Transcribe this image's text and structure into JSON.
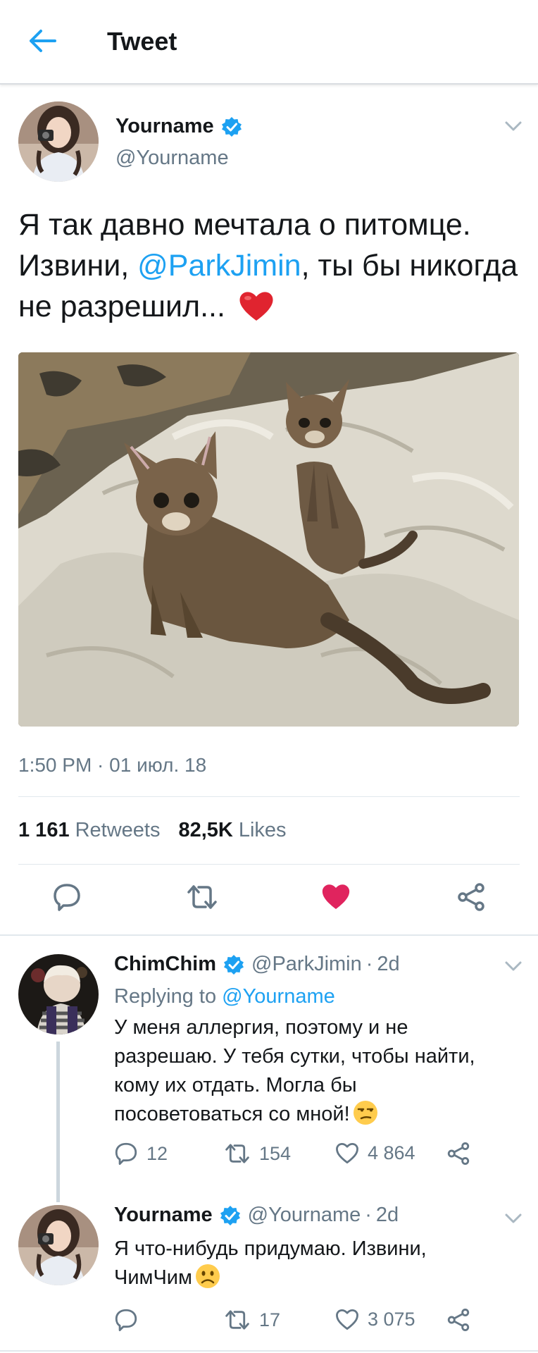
{
  "header": {
    "back_icon": "back-arrow-icon",
    "title": "Tweet"
  },
  "colors": {
    "accent": "#1da1f2",
    "like": "#e0245e",
    "secondary_text": "#657786"
  },
  "main_tweet": {
    "name": "Yourname",
    "handle": "@Yourname",
    "text_before": "Я так давно мечтала о питомце. Извини, ",
    "mention": "@ParkJimin",
    "text_after": ", ты бы никогда не разрешил... ",
    "time": "1:50 PM",
    "date_sep": " · ",
    "date": "01 июл. 18",
    "retweets_count": "1 161",
    "retweets_label": "Retweets",
    "likes_count": "82,5K",
    "likes_label": "Likes",
    "actions": [
      "reply-icon",
      "retweet-icon",
      "like-icon",
      "share-icon"
    ]
  },
  "replies": [
    {
      "name": "ChimChim",
      "handle": "@ParkJimin",
      "dot": "·",
      "time": "2d",
      "replying_prefix": "Replying to ",
      "replying_handle": "@Yourname",
      "text": "У меня аллергия, поэтому и не разрешаю. У тебя сутки, чтобы найти, кому их отдать. Могла бы посоветоваться со мной!",
      "emoji": "unamused-face",
      "reply_count": "12",
      "retweet_count": "154",
      "like_count": "4 864"
    },
    {
      "name": "Yourname",
      "handle": "@Yourname",
      "dot": "·",
      "time": "2d",
      "text": "Я что-нибудь придумаю. Извини, ЧимЧим",
      "emoji": "slightly-frowning-face",
      "reply_count": "",
      "retweet_count": "17",
      "like_count": "3 075"
    }
  ]
}
